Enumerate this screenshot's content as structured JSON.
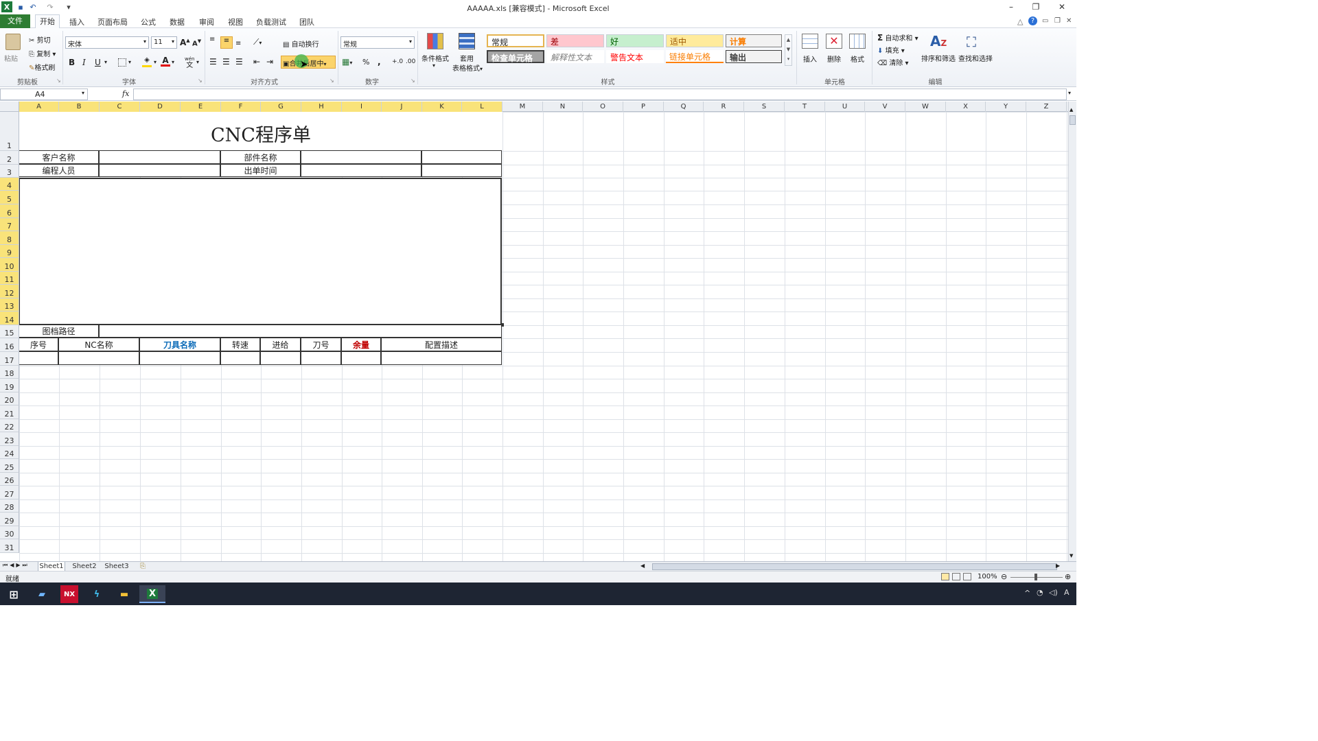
{
  "window": {
    "title": "AAAAA.xls  [兼容模式] - Microsoft Excel"
  },
  "tabs": [
    {
      "label": "文件"
    },
    {
      "label": "开始"
    },
    {
      "label": "插入"
    },
    {
      "label": "页面布局"
    },
    {
      "label": "公式"
    },
    {
      "label": "数据"
    },
    {
      "label": "审阅"
    },
    {
      "label": "视图"
    },
    {
      "label": "负载测试"
    },
    {
      "label": "团队"
    }
  ],
  "ribbon": {
    "clipboard": {
      "paste": "粘贴",
      "cut": "剪切",
      "copy": "复制",
      "format_painter": "格式刷",
      "label": "剪贴板"
    },
    "font": {
      "name": "宋体",
      "size": "11",
      "bold": "B",
      "italic": "I",
      "underline": "U",
      "wen": "wén",
      "label": "字体"
    },
    "alignment": {
      "wrap": "自动换行",
      "merge": "合并后居中",
      "label": "对齐方式"
    },
    "number": {
      "format": "常规",
      "label": "数字"
    },
    "styles": {
      "cond_format": "条件格式",
      "table_format_1": "套用",
      "table_format_2": "表格格式",
      "items": [
        {
          "label": "常规",
          "color": "#000000",
          "bg": "#ffffff"
        },
        {
          "label": "差",
          "color": "#9c0006",
          "bg": "#ffc7ce"
        },
        {
          "label": "好",
          "color": "#006100",
          "bg": "#c6efce"
        },
        {
          "label": "适中",
          "color": "#9c5700",
          "bg": "#ffeb9c"
        },
        {
          "label": "计算",
          "color": "#fa7d00",
          "bg": "#f2f2f2"
        },
        {
          "label": "检查单元格",
          "color": "#ffffff",
          "bg": "#a5a5a5"
        },
        {
          "label": "解释性文本",
          "color": "#7f7f7f",
          "bg": "#ffffff"
        },
        {
          "label": "警告文本",
          "color": "#ff0000",
          "bg": "#ffffff"
        },
        {
          "label": "链接单元格",
          "color": "#fa7d00",
          "bg": "#ffffff"
        },
        {
          "label": "输出",
          "color": "#3f3f3f",
          "bg": "#f2f2f2"
        }
      ],
      "label": "样式"
    },
    "cells": {
      "insert": "插入",
      "delete": "删除",
      "format": "格式",
      "label": "单元格"
    },
    "editing": {
      "autosum": "自动求和",
      "fill": "填充",
      "clear": "清除",
      "sort_filter": "排序和筛选",
      "find_select": "查找和选择",
      "label": "编辑"
    }
  },
  "formula_bar": {
    "name_box": "A4",
    "fx": "fx",
    "value": ""
  },
  "columns": [
    "A",
    "B",
    "C",
    "D",
    "E",
    "F",
    "G",
    "H",
    "I",
    "J",
    "K",
    "L",
    "M",
    "N",
    "O",
    "P",
    "Q",
    "R",
    "S",
    "T",
    "U",
    "V",
    "W",
    "X",
    "Y",
    "Z"
  ],
  "rows": [
    "1",
    "2",
    "3",
    "4",
    "5",
    "6",
    "7",
    "8",
    "9",
    "10",
    "11",
    "12",
    "13",
    "14",
    "15",
    "16",
    "17",
    "18",
    "19",
    "20",
    "21",
    "22",
    "23",
    "24",
    "25",
    "26",
    "27",
    "28",
    "29",
    "30",
    "31"
  ],
  "sheet": {
    "title": "CNC程序单",
    "customer_label": "客户名称",
    "part_label": "部件名称",
    "programmer_label": "编程人员",
    "date_label": "出单时间",
    "path_label": "图档路径",
    "headers": {
      "seq": "序号",
      "nc_name": "NC名称",
      "tool_name": "刀具名称",
      "speed": "转速",
      "feed": "进给",
      "tool_no": "刀号",
      "allowance": "余量",
      "desc": "配置描述"
    },
    "colors": {
      "tool_name": "#0b6bb8",
      "allowance": "#c00000"
    }
  },
  "sheet_tabs": [
    "Sheet1",
    "Sheet2",
    "Sheet3"
  ],
  "status": {
    "ready": "就绪",
    "zoom": "100%"
  }
}
